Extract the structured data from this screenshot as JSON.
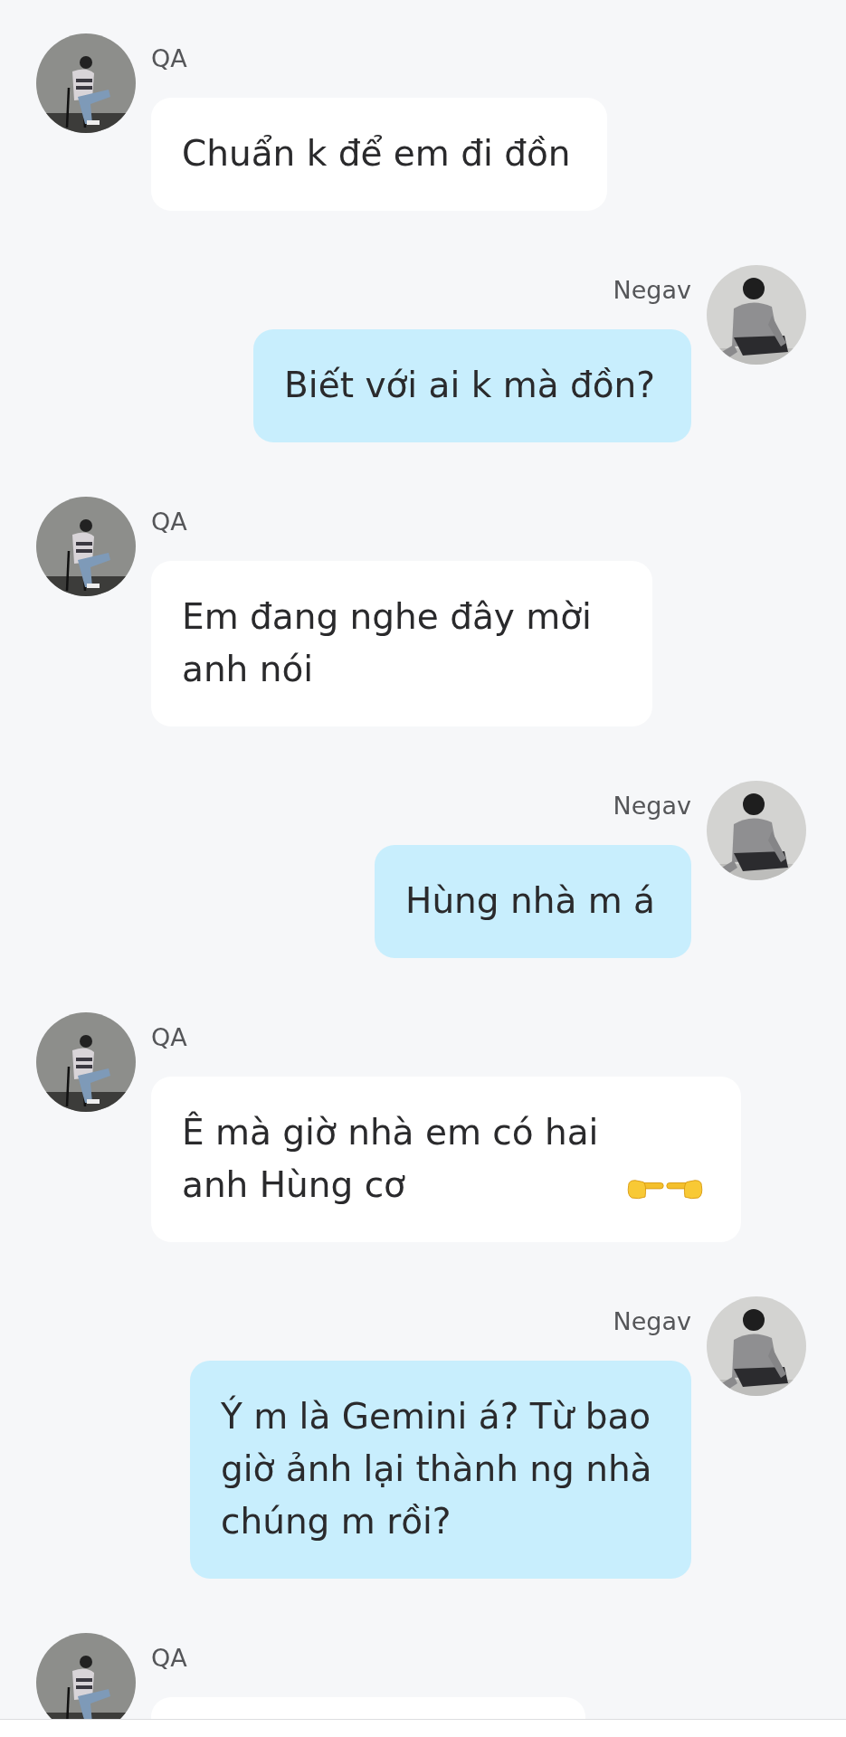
{
  "messages": [
    {
      "sender": "QA",
      "kind": "incoming",
      "text": "Chuẩn k để em đi đồn"
    },
    {
      "sender": "Negav",
      "kind": "outgoing",
      "text": "Biết với ai k mà đồn?"
    },
    {
      "sender": "QA",
      "kind": "incoming",
      "text": "Em đang nghe đây mời anh nói"
    },
    {
      "sender": "Negav",
      "kind": "outgoing",
      "text": "Hùng nhà m á"
    },
    {
      "sender": "QA",
      "kind": "incoming",
      "text": "Ê mà giờ nhà em có hai anh Hùng cơ",
      "trailing_icons": [
        {
          "kind": "point-right"
        },
        {
          "kind": "point-left"
        }
      ]
    },
    {
      "sender": "Negav",
      "kind": "outgoing",
      "text": "Ý m là Gemini á? Từ bao giờ ảnh lại thành ng nhà chúng m rồi?"
    },
    {
      "sender": "QA",
      "kind": "incoming"
    }
  ]
}
